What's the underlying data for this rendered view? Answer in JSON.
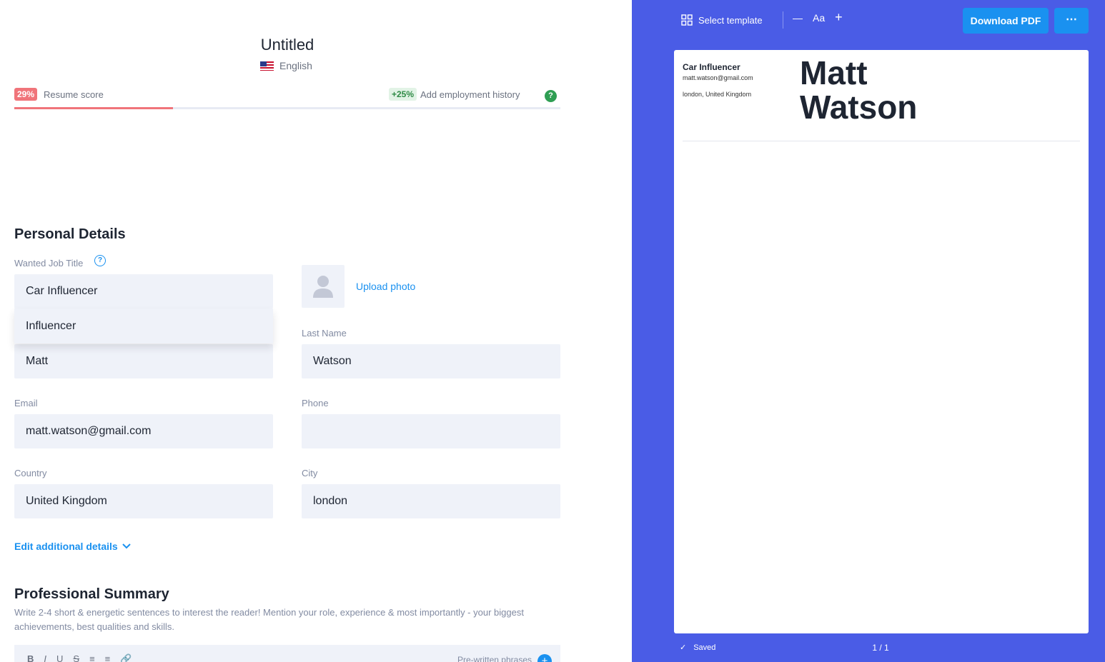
{
  "header": {
    "title": "Untitled",
    "language": "English"
  },
  "score": {
    "percent_label": "29%",
    "percent_value": 0.29,
    "label": "Resume score",
    "tip_badge": "+25%",
    "tip_label": "Add employment history",
    "help_symbol": "?"
  },
  "personal": {
    "heading": "Personal Details",
    "job_title_label": "Wanted Job Title",
    "job_title_value": "Car Influencer",
    "job_suggestions": [
      "Influencer"
    ],
    "first_name_value": "Matt",
    "last_name_label": "Last Name",
    "last_name_value": "Watson",
    "email_label": "Email",
    "email_value": "matt.watson@gmail.com",
    "phone_label": "Phone",
    "phone_value": "",
    "country_label": "Country",
    "country_value": "United Kingdom",
    "city_label": "City",
    "city_value": "london",
    "upload_photo": "Upload photo",
    "edit_details": "Edit additional details"
  },
  "summary": {
    "heading": "Professional Summary",
    "description": "Write 2-4 short & energetic sentences to interest the reader! Mention your role, experience & most importantly - your biggest achievements, best qualities and skills.",
    "tools": [
      "B",
      "I",
      "U",
      "S",
      "≡",
      "≡",
      "🔗"
    ],
    "phrases": "Pre-written phrases"
  },
  "preview": {
    "select_template": "Select template",
    "font_label": "Aa",
    "download": "Download PDF",
    "more": "⋯",
    "resume": {
      "job_title": "Car Influencer",
      "email": "matt.watson@gmail.com",
      "location": "london, United Kingdom",
      "first_name": "Matt",
      "last_name": "Watson"
    },
    "status": "Saved",
    "page": "1 / 1"
  },
  "colors": {
    "accent_blue": "#1a91f0",
    "score_red": "#f0747a",
    "tip_green": "#2f9e53",
    "preview_bg": "#4a5ce6",
    "input_bg": "#eff2f9"
  },
  "icons": [
    "us-flag-icon",
    "help-icon",
    "avatar-placeholder-icon",
    "chevron-down-icon",
    "grid-icon",
    "minus-icon",
    "plus-icon",
    "check-icon"
  ]
}
